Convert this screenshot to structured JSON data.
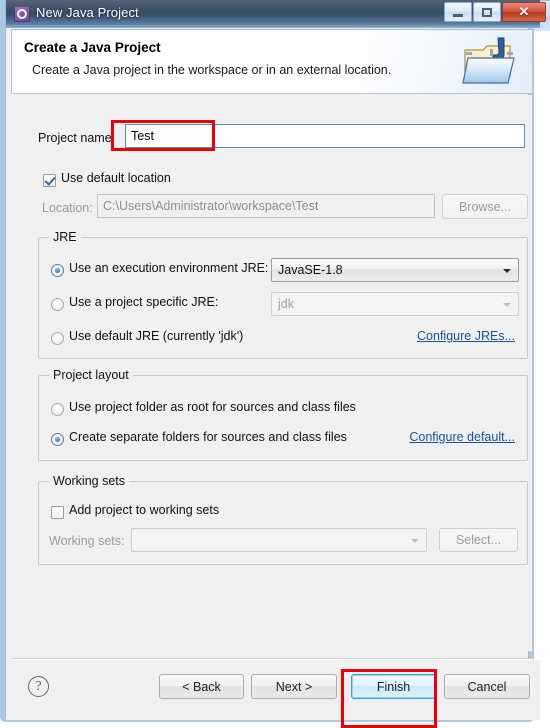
{
  "window": {
    "title": "New Java Project",
    "app_icon": "gear-icon",
    "controls": {
      "minimize": "–",
      "maximize": "□",
      "close": "✕"
    }
  },
  "background_window": {
    "visible": true,
    "title_blurred": true
  },
  "header": {
    "title": "Create a Java Project",
    "description": "Create a Java project in the workspace or in an external location.",
    "icon": "java-project-folder-icon"
  },
  "form": {
    "project_name": {
      "label": "Project name:",
      "value": "Test",
      "placeholder": ""
    },
    "use_default_location": {
      "label": "Use default location",
      "checked": true
    },
    "location": {
      "label": "Location:",
      "value": "C:\\Users\\Administrator\\workspace\\Test",
      "disabled": true,
      "browse_label": "Browse..."
    }
  },
  "jre_group": {
    "title": "JRE",
    "options": [
      {
        "label": "Use an execution environment JRE:",
        "selected": true
      },
      {
        "label": "Use a project specific JRE:",
        "selected": false
      },
      {
        "label": "Use default JRE (currently 'jdk')",
        "selected": false
      }
    ],
    "execution_environment_value": "JavaSE-1.8",
    "project_specific_value": "jdk",
    "configure_link": "Configure JREs..."
  },
  "project_layout_group": {
    "title": "Project layout",
    "options": [
      {
        "label": "Use project folder as root for sources and class files",
        "selected": false
      },
      {
        "label": "Create separate folders for sources and class files",
        "selected": true
      }
    ],
    "configure_link": "Configure default..."
  },
  "working_sets_group": {
    "title": "Working sets",
    "add_checkbox": {
      "label": "Add project to working sets",
      "checked": false
    },
    "working_sets_label": "Working sets:",
    "working_sets_value": "",
    "select_label": "Select..."
  },
  "footer": {
    "help_glyph": "?",
    "buttons": [
      {
        "label": "< Back",
        "state": "normal"
      },
      {
        "label": "Next >",
        "state": "normal"
      },
      {
        "label": "Finish",
        "state": "primary"
      },
      {
        "label": "Cancel",
        "state": "normal"
      }
    ]
  },
  "annotations": {
    "accent_color": "#ef0000",
    "boxes": [
      {
        "target": "project-name-input"
      },
      {
        "target": "finish-button"
      }
    ]
  }
}
